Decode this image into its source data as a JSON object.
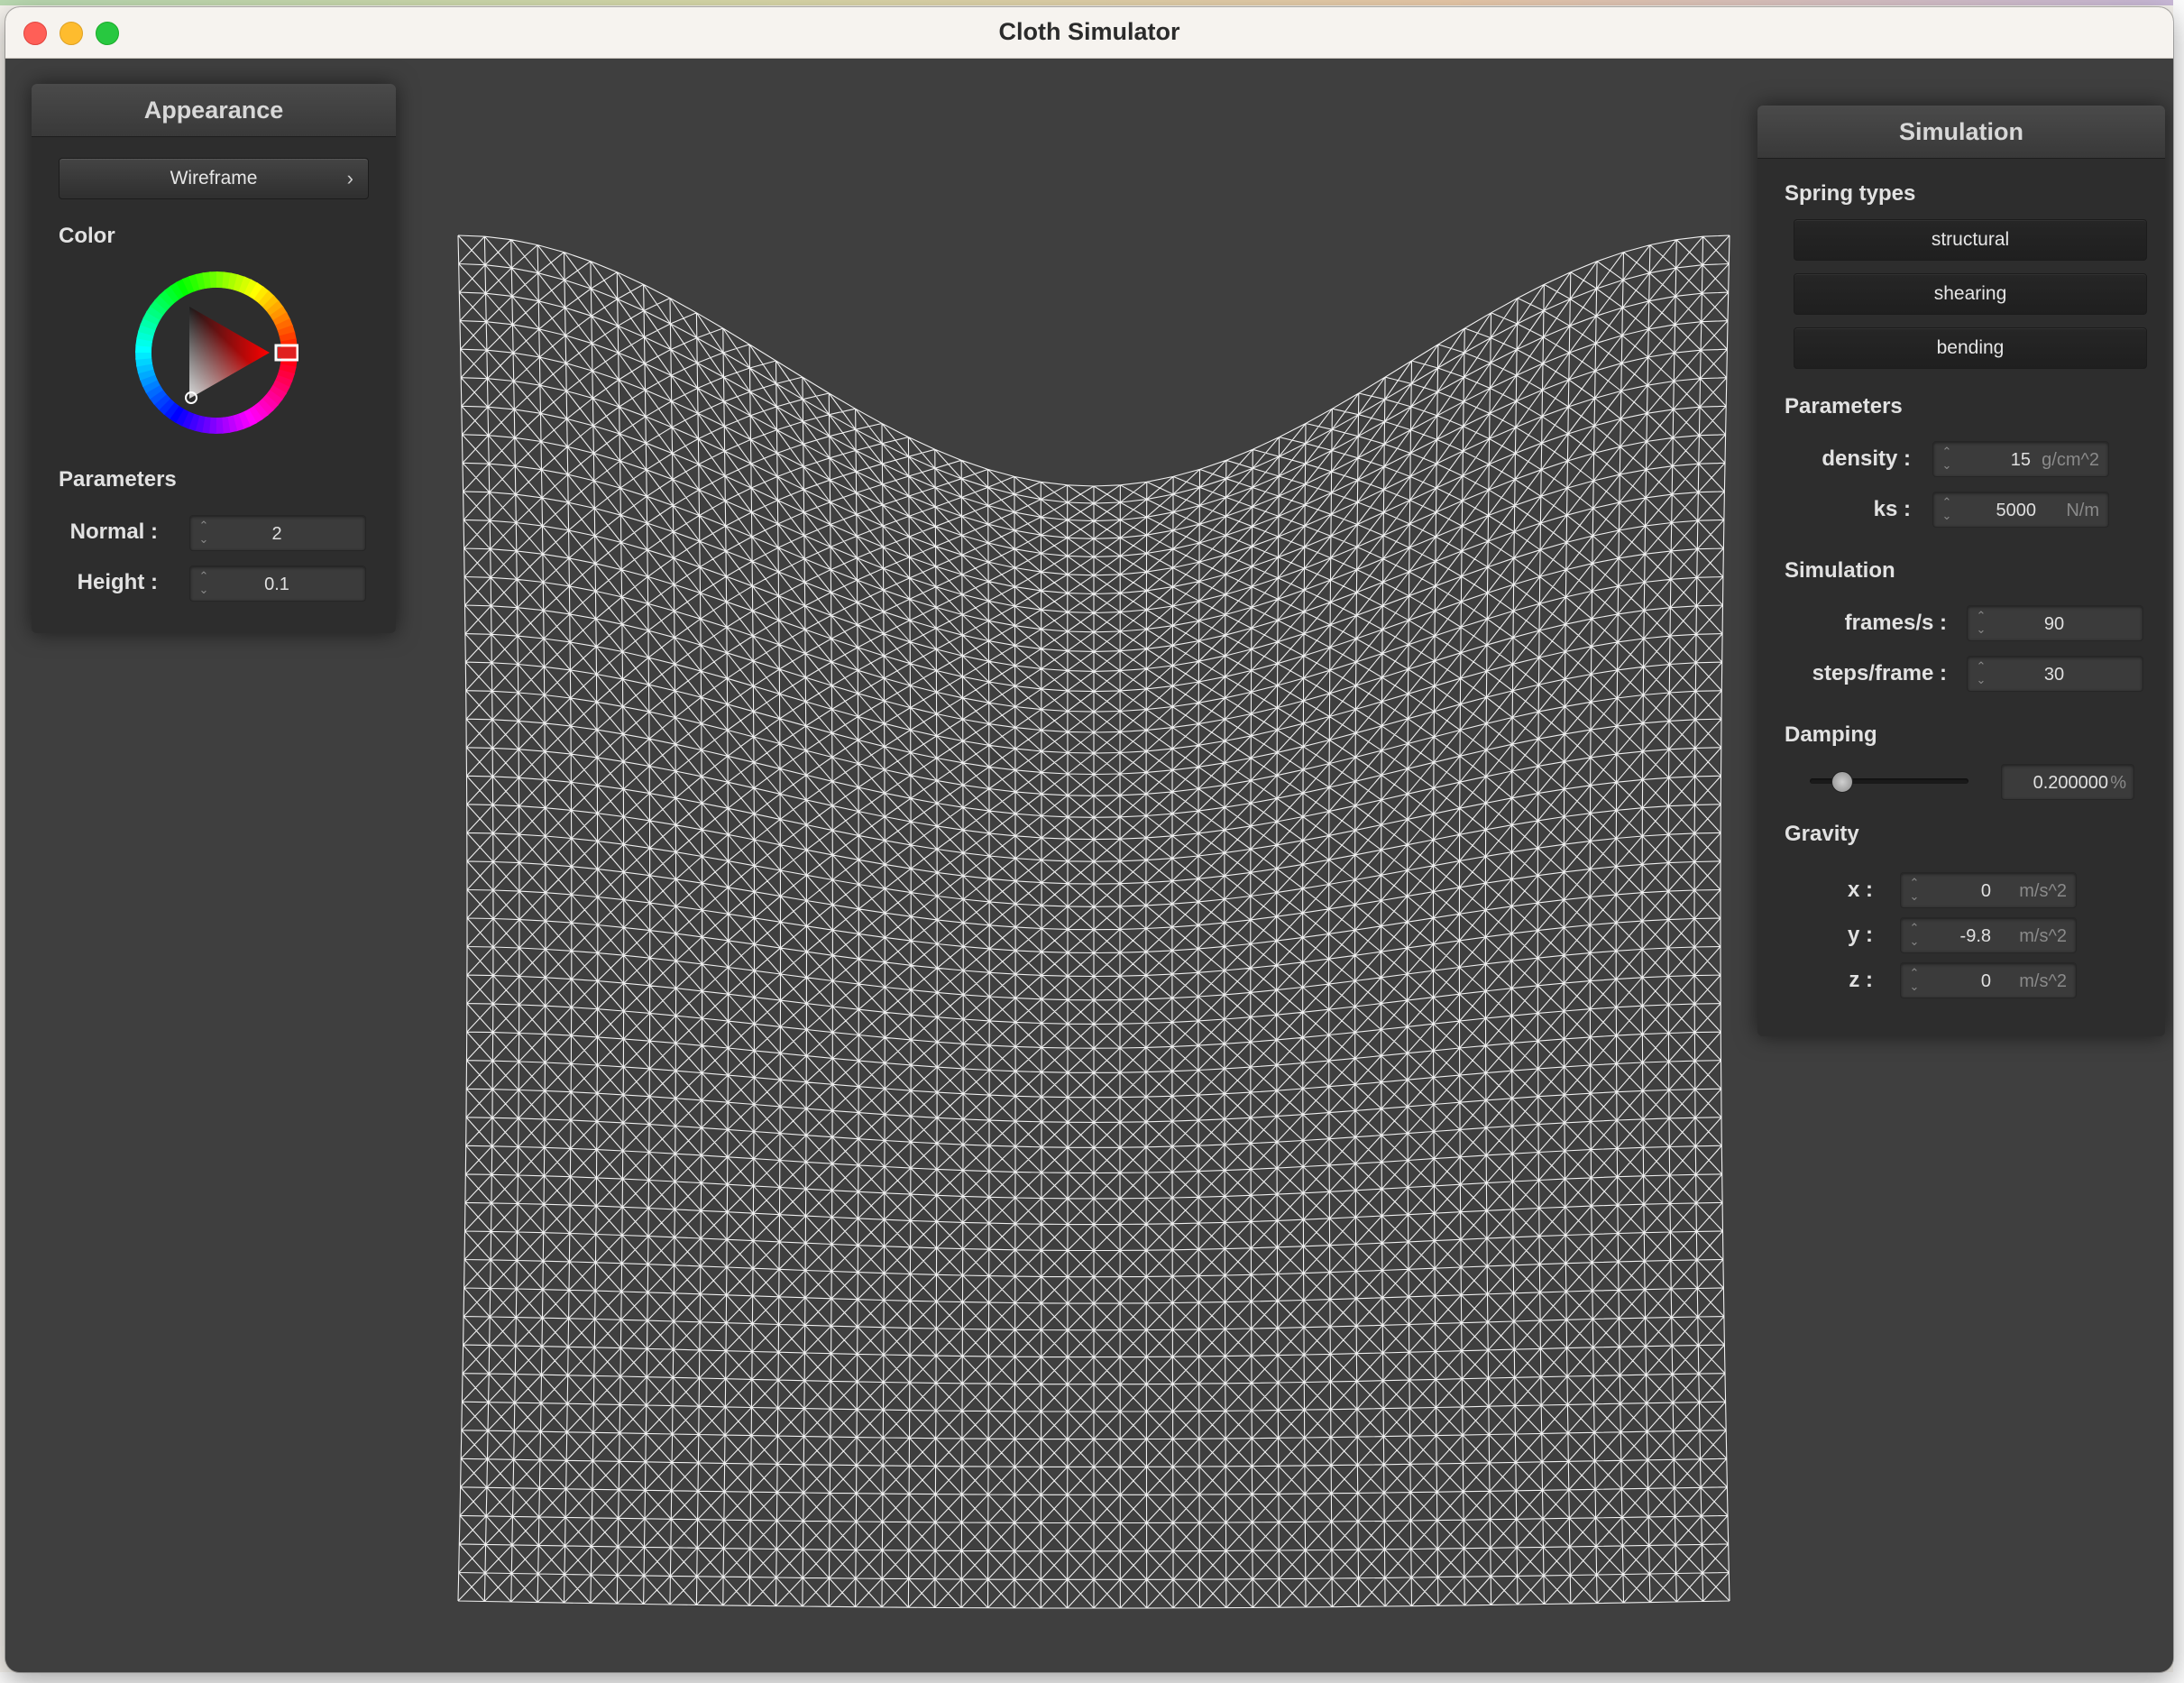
{
  "window": {
    "title": "Cloth Simulator"
  },
  "appearance": {
    "title": "Appearance",
    "shader_button": "Wireframe",
    "color_label": "Color",
    "parameters_label": "Parameters",
    "normal_label": "Normal :",
    "normal_value": "2",
    "height_label": "Height :",
    "height_value": "0.1",
    "selected_color": "#ff0000"
  },
  "simulation": {
    "title": "Simulation",
    "spring_types_label": "Spring types",
    "spring_types": [
      "structural",
      "shearing",
      "bending"
    ],
    "parameters_label": "Parameters",
    "density_label": "density :",
    "density_value": "15",
    "density_unit": "g/cm^2",
    "ks_label": "ks :",
    "ks_value": "5000",
    "ks_unit": "N/m",
    "simulation_label": "Simulation",
    "fps_label": "frames/s :",
    "fps_value": "90",
    "steps_label": "steps/frame :",
    "steps_value": "30",
    "damping_label": "Damping",
    "damping_value": "0.200000",
    "damping_unit": "%",
    "damping_fraction": 0.2,
    "gravity_label": "Gravity",
    "gravity_x_label": "x :",
    "gravity_x_value": "0",
    "gravity_y_label": "y :",
    "gravity_y_value": "-9.8",
    "gravity_z_label": "z :",
    "gravity_z_value": "0",
    "gravity_unit": "m/s^2"
  },
  "scene": {
    "wire_color": "#ffffff",
    "background": "#3f3f3f"
  },
  "icons": {
    "chevron": "chevron-right-icon",
    "spinner": "up-down-spinner-icon",
    "color_wheel": "color-wheel-icon"
  }
}
